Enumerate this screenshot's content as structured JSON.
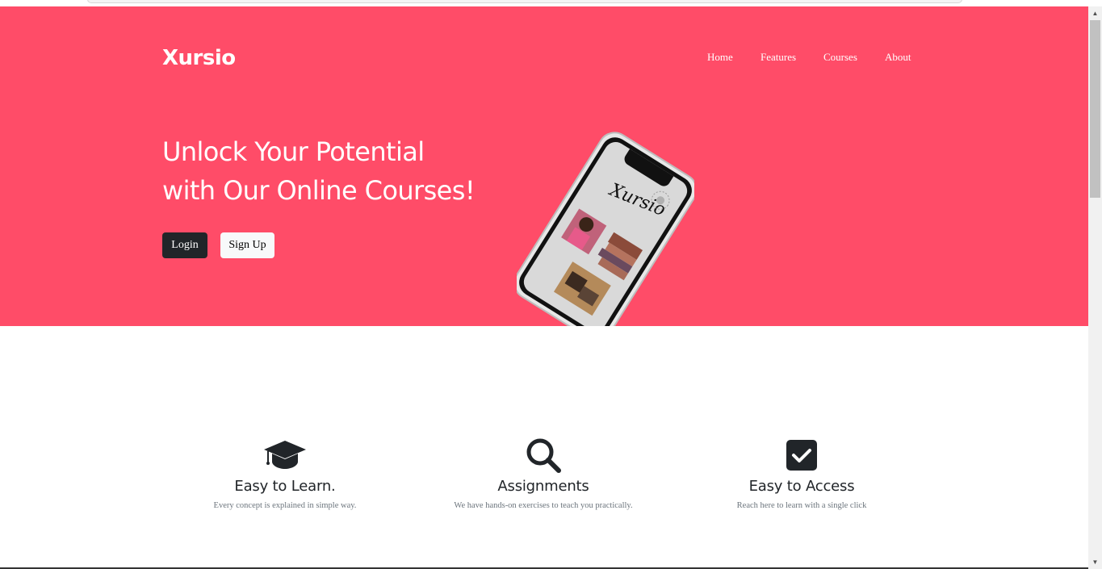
{
  "brand": "Xursio",
  "nav": [
    {
      "label": "Home"
    },
    {
      "label": "Features"
    },
    {
      "label": "Courses"
    },
    {
      "label": "About"
    }
  ],
  "hero": {
    "headline_line1": "Unlock Your Potential",
    "headline_line2": "with Our Online Courses!",
    "login_label": "Login",
    "signup_label": "Sign Up",
    "phone_screen_text": "Xursio"
  },
  "features": [
    {
      "icon": "graduation-cap-icon",
      "title": "Easy to Learn.",
      "description": "Every concept is explained in simple way."
    },
    {
      "icon": "search-icon",
      "title": "Assignments",
      "description": "We have hands-on exercises to teach you practically."
    },
    {
      "icon": "checkbox-checked-icon",
      "title": "Easy to Access",
      "description": "Reach here to learn with a single click"
    }
  ],
  "colors": {
    "hero_bg": "#ff4c68",
    "dark_button": "#212529",
    "light_button": "#f8f9fa",
    "text_dark": "#212529",
    "text_muted": "#6c757d"
  }
}
